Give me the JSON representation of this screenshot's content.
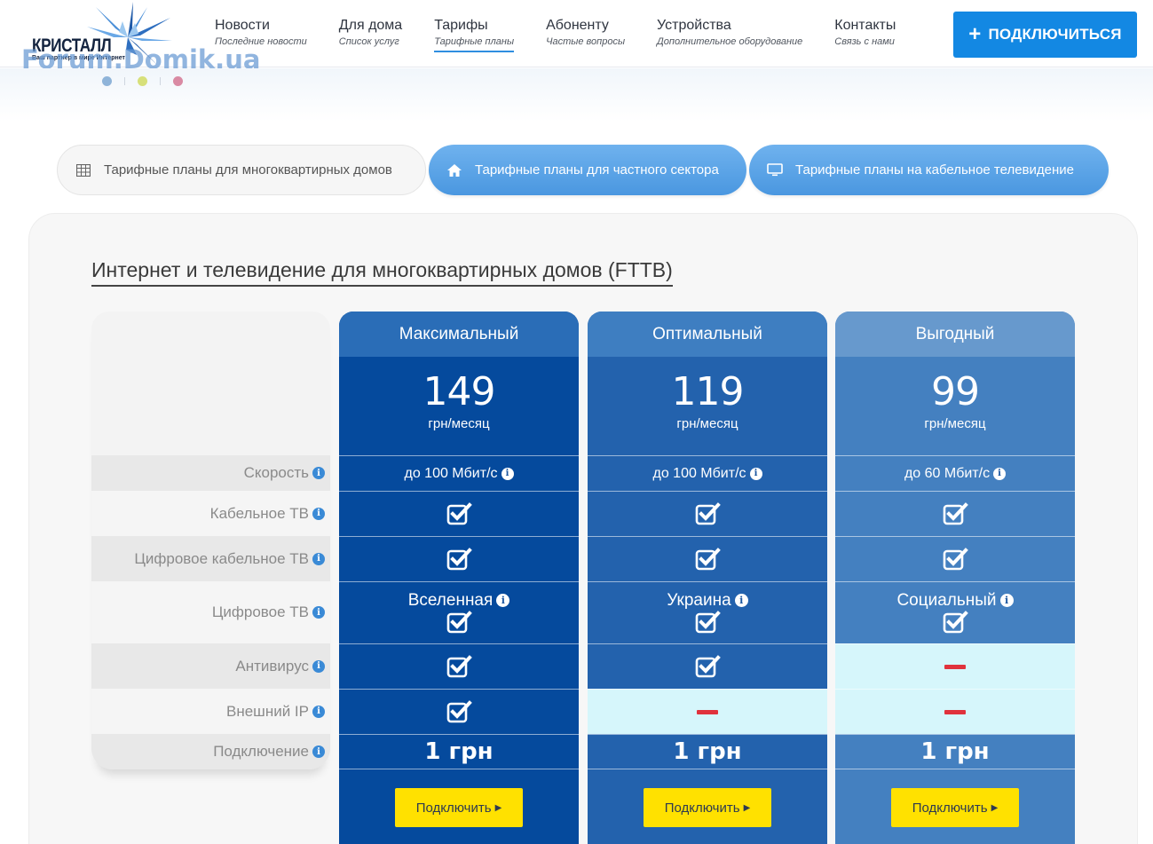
{
  "brand": {
    "name": "КРИСТАЛЛ",
    "tagline": "Ваш партнер в мире Интернет",
    "watermark": "Forum.Domik.ua",
    "dot_colors": [
      "#8fb4d9",
      "#d7e07a",
      "#d98aa3"
    ]
  },
  "nav": [
    {
      "title": "Новости",
      "subtitle": "Последние новости",
      "active": false
    },
    {
      "title": "Для дома",
      "subtitle": "Список услуг",
      "active": false
    },
    {
      "title": "Тарифы",
      "subtitle": "Тарифные планы",
      "active": true
    },
    {
      "title": "Абоненту",
      "subtitle": "Частые вопросы",
      "active": false
    },
    {
      "title": "Устройства",
      "subtitle": "Дополнительное оборудование",
      "active": false
    },
    {
      "title": "Контакты",
      "subtitle": "Связь с нами",
      "active": false
    }
  ],
  "header_button": {
    "label": "ПОДКЛЮЧИТЬСЯ",
    "icon": "plus-icon"
  },
  "tabs": [
    {
      "label": "Тарифные планы для многоквартирных домов",
      "icon": "table-icon",
      "selected": true
    },
    {
      "label": "Тарифные планы для частного сектора",
      "icon": "home-icon",
      "selected": false
    },
    {
      "label": "Тарифные планы на кабельное телевидение",
      "icon": "monitor-icon",
      "selected": false
    }
  ],
  "section_title": "Интернет и телевидение для многоквартирных домов (FTTB)",
  "row_labels": [
    "Скорость",
    "Кабельное ТВ",
    "Цифровое кабельное ТВ",
    "Цифровое ТВ",
    "Антивирус",
    "Внешний IP",
    "Подключение"
  ],
  "plans": [
    {
      "name": "Максимальный",
      "price": "149",
      "price_unit": "грн/месяц",
      "speed": "до 100 Мбит/с",
      "cable_tv": true,
      "digital_cable_tv": true,
      "digital_tv_package": "Вселенная",
      "digital_tv": true,
      "antivirus": true,
      "external_ip": true,
      "connection_fee": "1 грн",
      "button_label": "Подключить",
      "colors": {
        "head": "#2a6db7",
        "body": "#054a9d"
      }
    },
    {
      "name": "Оптимальный",
      "price": "119",
      "price_unit": "грн/месяц",
      "speed": "до 100 Мбит/с",
      "cable_tv": true,
      "digital_cable_tv": true,
      "digital_tv_package": "Украина",
      "digital_tv": true,
      "antivirus": true,
      "external_ip": false,
      "connection_fee": "1 грн",
      "button_label": "Подключить",
      "colors": {
        "head": "#3e7ec1",
        "body": "#2362ad"
      }
    },
    {
      "name": "Выгодный",
      "price": "99",
      "price_unit": "грн/месяц",
      "speed": "до 60 Мбит/с",
      "cable_tv": true,
      "digital_cable_tv": true,
      "digital_tv_package": "Социальный",
      "digital_tv": true,
      "antivirus": false,
      "external_ip": false,
      "connection_fee": "1 грн",
      "button_label": "Подключить",
      "colors": {
        "head": "#6799cd",
        "body": "#4480c0"
      }
    }
  ],
  "accent_colors": {
    "primary_button": "#1388e3",
    "tab_active": "#4a97e0",
    "plan_button": "#ffe100",
    "unavailable": "#e0323c",
    "unavailable_bg": "#d6f6fb"
  }
}
